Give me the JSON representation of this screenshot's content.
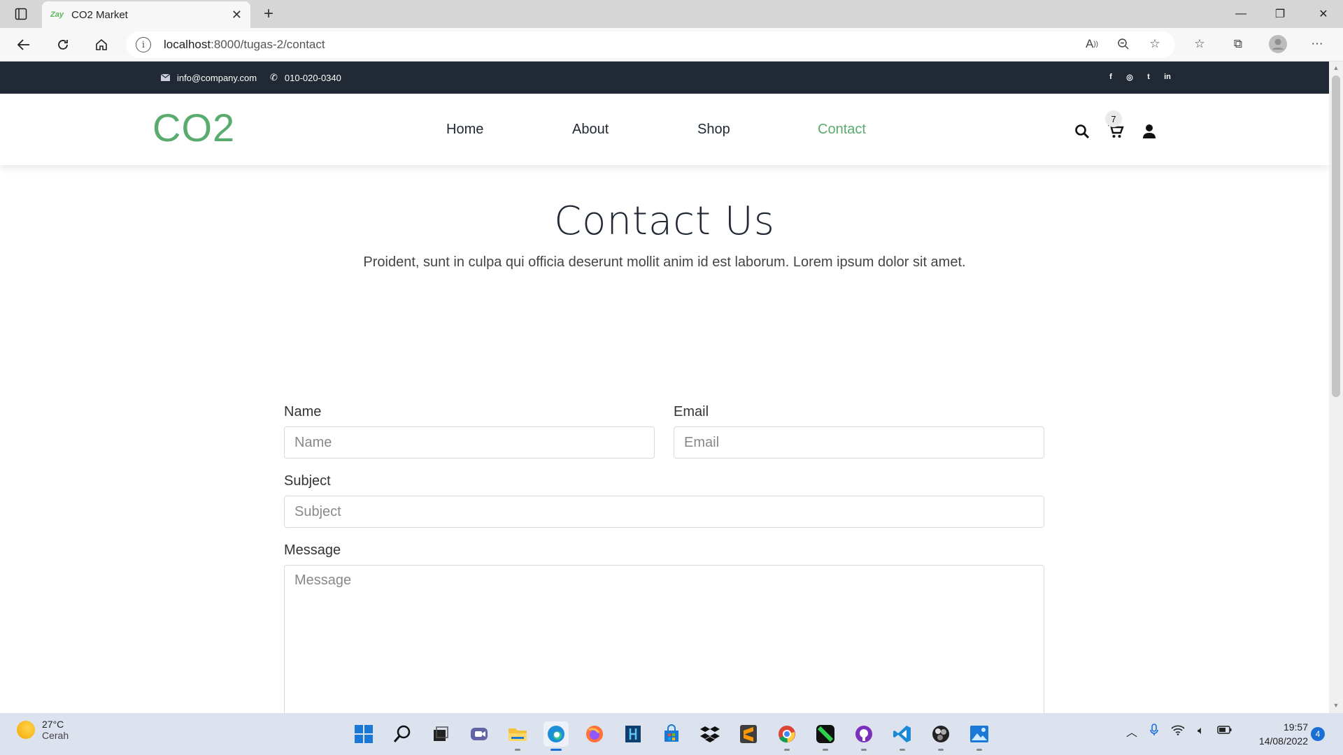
{
  "browser": {
    "tab_favicon": "Zay",
    "tab_title": "CO2 Market",
    "url_host": "localhost",
    "url_path": ":8000/tugas-2/contact"
  },
  "topinfo": {
    "email": "info@company.com",
    "phone": "010-020-0340",
    "social": [
      "f",
      "◎",
      "t",
      "in"
    ]
  },
  "navbar": {
    "brand": "CO2",
    "links": [
      "Home",
      "About",
      "Shop",
      "Contact"
    ],
    "active": "Contact",
    "cart_count": "7",
    "accent": "#59ab6e"
  },
  "contact": {
    "title": "Contact Us",
    "subtitle": "Proident, sunt in culpa qui officia deserunt mollit anim id est laborum. Lorem ipsum dolor sit amet.",
    "fields": {
      "name_label": "Name",
      "name_placeholder": "Name",
      "email_label": "Email",
      "email_placeholder": "Email",
      "subject_label": "Subject",
      "subject_placeholder": "Subject",
      "message_label": "Message",
      "message_placeholder": "Message"
    }
  },
  "taskbar": {
    "temperature": "27°C",
    "weather": "Cerah",
    "time": "19:57",
    "date": "14/08/2022",
    "notifications": "4"
  }
}
